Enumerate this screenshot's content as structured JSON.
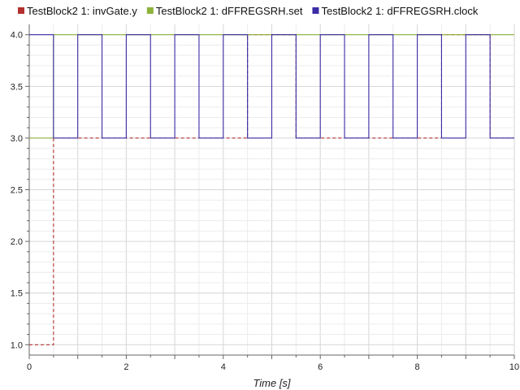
{
  "chart_data": {
    "type": "line",
    "title": "",
    "xlabel": "Time [s]",
    "ylabel": "",
    "xlim": [
      0,
      10
    ],
    "ylim": [
      0.9,
      4.1
    ],
    "x_ticks": [
      0,
      2,
      4,
      6,
      8,
      10
    ],
    "y_ticks": [
      1.0,
      1.5,
      2.0,
      2.5,
      3.0,
      3.5,
      4.0
    ],
    "grid": true,
    "legend_position": "top",
    "series": [
      {
        "name": "TestBlock2 1: invGate.y",
        "color": "#b3302e",
        "style": "dashed",
        "points": [
          [
            0,
            1
          ],
          [
            0.5,
            1
          ],
          [
            0.5,
            3
          ],
          [
            4.5,
            3
          ],
          [
            4.5,
            4
          ],
          [
            5.5,
            4
          ],
          [
            5.5,
            3
          ],
          [
            8.5,
            3
          ],
          [
            8.5,
            4
          ],
          [
            9.5,
            4
          ],
          [
            9.5,
            3
          ],
          [
            10,
            3
          ]
        ]
      },
      {
        "name": "TestBlock2 1: dFFREGSRH.set",
        "color": "#8db33a",
        "style": "solid",
        "points": [
          [
            0,
            3
          ],
          [
            0.5,
            3
          ],
          [
            0.5,
            4
          ],
          [
            10,
            4
          ]
        ]
      },
      {
        "name": "TestBlock2 1: dFFREGSRH.clock",
        "color": "#3b2ca6",
        "style": "solid",
        "points": [
          [
            0,
            4
          ],
          [
            0.5,
            4
          ],
          [
            0.5,
            3
          ],
          [
            1,
            3
          ],
          [
            1,
            4
          ],
          [
            1.5,
            4
          ],
          [
            1.5,
            3
          ],
          [
            2,
            3
          ],
          [
            2,
            4
          ],
          [
            2.5,
            4
          ],
          [
            2.5,
            3
          ],
          [
            3,
            3
          ],
          [
            3,
            4
          ],
          [
            3.5,
            4
          ],
          [
            3.5,
            3
          ],
          [
            4,
            3
          ],
          [
            4,
            4
          ],
          [
            4.5,
            4
          ],
          [
            4.5,
            3
          ],
          [
            5,
            3
          ],
          [
            5,
            4
          ],
          [
            5.5,
            4
          ],
          [
            5.5,
            3
          ],
          [
            6,
            3
          ],
          [
            6,
            4
          ],
          [
            6.5,
            4
          ],
          [
            6.5,
            3
          ],
          [
            7,
            3
          ],
          [
            7,
            4
          ],
          [
            7.5,
            4
          ],
          [
            7.5,
            3
          ],
          [
            8,
            3
          ],
          [
            8,
            4
          ],
          [
            8.5,
            4
          ],
          [
            8.5,
            3
          ],
          [
            9,
            3
          ],
          [
            9,
            4
          ],
          [
            9.5,
            4
          ],
          [
            9.5,
            3
          ],
          [
            10,
            3
          ]
        ]
      }
    ]
  }
}
